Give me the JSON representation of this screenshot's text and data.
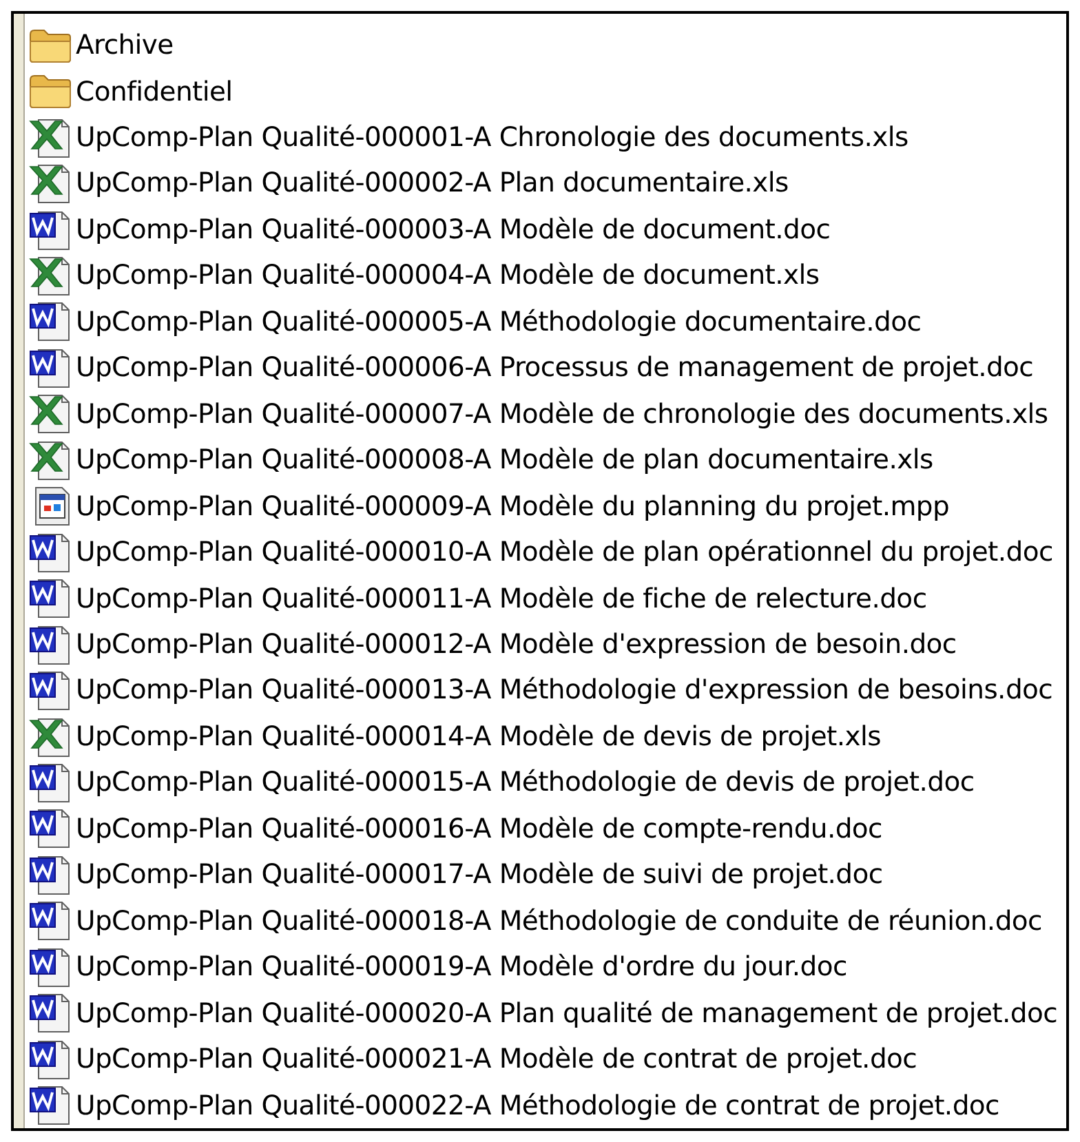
{
  "files": [
    {
      "kind": "folder",
      "name": "Archive"
    },
    {
      "kind": "folder",
      "name": "Confidentiel"
    },
    {
      "kind": "excel",
      "name": "UpComp-Plan Qualité-000001-A Chronologie des documents.xls"
    },
    {
      "kind": "excel",
      "name": "UpComp-Plan Qualité-000002-A Plan documentaire.xls"
    },
    {
      "kind": "word",
      "name": "UpComp-Plan Qualité-000003-A Modèle de document.doc"
    },
    {
      "kind": "excel",
      "name": "UpComp-Plan Qualité-000004-A Modèle de document.xls"
    },
    {
      "kind": "word",
      "name": "UpComp-Plan Qualité-000005-A Méthodologie documentaire.doc"
    },
    {
      "kind": "word",
      "name": "UpComp-Plan Qualité-000006-A Processus de management de projet.doc"
    },
    {
      "kind": "excel",
      "name": "UpComp-Plan Qualité-000007-A Modèle de chronologie des documents.xls"
    },
    {
      "kind": "excel",
      "name": "UpComp-Plan Qualité-000008-A Modèle de plan documentaire.xls"
    },
    {
      "kind": "project",
      "name": "UpComp-Plan Qualité-000009-A Modèle du planning du projet.mpp"
    },
    {
      "kind": "word",
      "name": "UpComp-Plan Qualité-000010-A Modèle de plan opérationnel du projet.doc"
    },
    {
      "kind": "word",
      "name": "UpComp-Plan Qualité-000011-A Modèle de fiche de relecture.doc"
    },
    {
      "kind": "word",
      "name": "UpComp-Plan Qualité-000012-A Modèle d'expression de besoin.doc"
    },
    {
      "kind": "word",
      "name": "UpComp-Plan Qualité-000013-A Méthodologie d'expression de besoins.doc"
    },
    {
      "kind": "excel",
      "name": "UpComp-Plan Qualité-000014-A Modèle de devis de projet.xls"
    },
    {
      "kind": "word",
      "name": "UpComp-Plan Qualité-000015-A Méthodologie de devis de projet.doc"
    },
    {
      "kind": "word",
      "name": "UpComp-Plan Qualité-000016-A Modèle de compte-rendu.doc"
    },
    {
      "kind": "word",
      "name": "UpComp-Plan Qualité-000017-A Modèle de suivi de projet.doc"
    },
    {
      "kind": "word",
      "name": "UpComp-Plan Qualité-000018-A Méthodologie de conduite de réunion.doc"
    },
    {
      "kind": "word",
      "name": "UpComp-Plan Qualité-000019-A Modèle d'ordre du jour.doc"
    },
    {
      "kind": "word",
      "name": "UpComp-Plan Qualité-000020-A Plan qualité de management de projet.doc"
    },
    {
      "kind": "word",
      "name": "UpComp-Plan Qualité-000021-A Modèle de contrat de projet.doc"
    },
    {
      "kind": "word",
      "name": "UpComp-Plan Qualité-000022-A Méthodologie de contrat de projet.doc"
    }
  ]
}
